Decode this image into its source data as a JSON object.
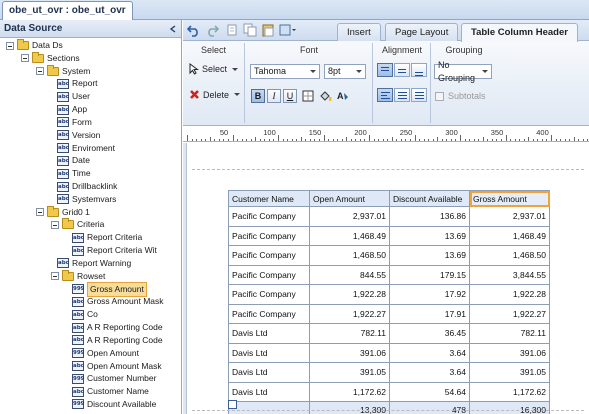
{
  "document_tab": "obe_ut_ovr : obe_ut_ovr",
  "left_panel": {
    "title": "Data Source",
    "tree": [
      {
        "label": "Data Ds",
        "icon": "folder"
      },
      {
        "label": "Sections",
        "icon": "folder"
      },
      {
        "label": "System",
        "icon": "folder"
      },
      {
        "label": "Report",
        "icon": "abc"
      },
      {
        "label": "User",
        "icon": "abc"
      },
      {
        "label": "App",
        "icon": "abc"
      },
      {
        "label": "Form",
        "icon": "abc"
      },
      {
        "label": "Version",
        "icon": "abc"
      },
      {
        "label": "Enviroment",
        "icon": "abc"
      },
      {
        "label": "Date",
        "icon": "abc"
      },
      {
        "label": "Time",
        "icon": "abc"
      },
      {
        "label": "Drillbacklink",
        "icon": "abc"
      },
      {
        "label": "Systemvars",
        "icon": "abc"
      },
      {
        "label": "Grid0 1",
        "icon": "folder"
      },
      {
        "label": "Criteria",
        "icon": "folder"
      },
      {
        "label": "Report Criteria",
        "icon": "abc"
      },
      {
        "label": "Report Criteria Wit",
        "icon": "abc"
      },
      {
        "label": "Report Warning",
        "icon": "abc"
      },
      {
        "label": "Rowset",
        "icon": "folder"
      },
      {
        "label": "Gross Amount",
        "icon": "999"
      },
      {
        "label": "Gross Amount Mask",
        "icon": "abc"
      },
      {
        "label": "Co",
        "icon": "abc"
      },
      {
        "label": "A R Reporting Code",
        "icon": "abc"
      },
      {
        "label": "A R Reporting Code",
        "icon": "abc"
      },
      {
        "label": "Open Amount",
        "icon": "999"
      },
      {
        "label": "Open Amount Mask",
        "icon": "abc"
      },
      {
        "label": "Customer Number",
        "icon": "999"
      },
      {
        "label": "Customer Name",
        "icon": "abc"
      },
      {
        "label": "Discount Available",
        "icon": "999"
      }
    ]
  },
  "toolbar": {
    "tabs": [
      "Insert",
      "Page Layout",
      "Table Column Header"
    ],
    "active_tab": "Table Column Header",
    "groups": {
      "select": {
        "title": "Select",
        "select_label": "Select",
        "delete_label": "Delete"
      },
      "font": {
        "title": "Font",
        "font_name": "Tahoma",
        "font_size": "8pt",
        "bold": "B",
        "italic": "I",
        "underline": "U"
      },
      "alignment": {
        "title": "Alignment"
      },
      "grouping": {
        "title": "Grouping",
        "grouping_value": "No Grouping",
        "subtotals_label": "Subtotals"
      }
    }
  },
  "ruler": {
    "labels": [
      "50",
      "100",
      "150",
      "200",
      "250",
      "300",
      "350",
      "400"
    ]
  },
  "table": {
    "headers": [
      "Customer Name",
      "Open Amount",
      "Discount Available",
      "Gross Amount"
    ],
    "selected_header": "Gross Amount",
    "rows": [
      [
        "Pacific Company",
        "2,937.01",
        "136.86",
        "2,937.01"
      ],
      [
        "Pacific Company",
        "1,468.49",
        "13.69",
        "1,468.49"
      ],
      [
        "Pacific Company",
        "1,468.50",
        "13.69",
        "1,468.50"
      ],
      [
        "Pacific Company",
        "844.55",
        "179.15",
        "3,844.55"
      ],
      [
        "Pacific Company",
        "1,922.28",
        "17.92",
        "1,922.28"
      ],
      [
        "Pacific Company",
        "1,922.27",
        "17.91",
        "1,922.27"
      ],
      [
        "Davis Ltd",
        "782.11",
        "36.45",
        "782.11"
      ],
      [
        "Davis Ltd",
        "391.06",
        "3.64",
        "391.06"
      ],
      [
        "Davis Ltd",
        "391.05",
        "3.64",
        "391.05"
      ],
      [
        "Davis Ltd",
        "1,172.62",
        "54.64",
        "1,172.62"
      ]
    ],
    "totals": [
      "",
      "13,300",
      "478",
      "16,300"
    ]
  }
}
